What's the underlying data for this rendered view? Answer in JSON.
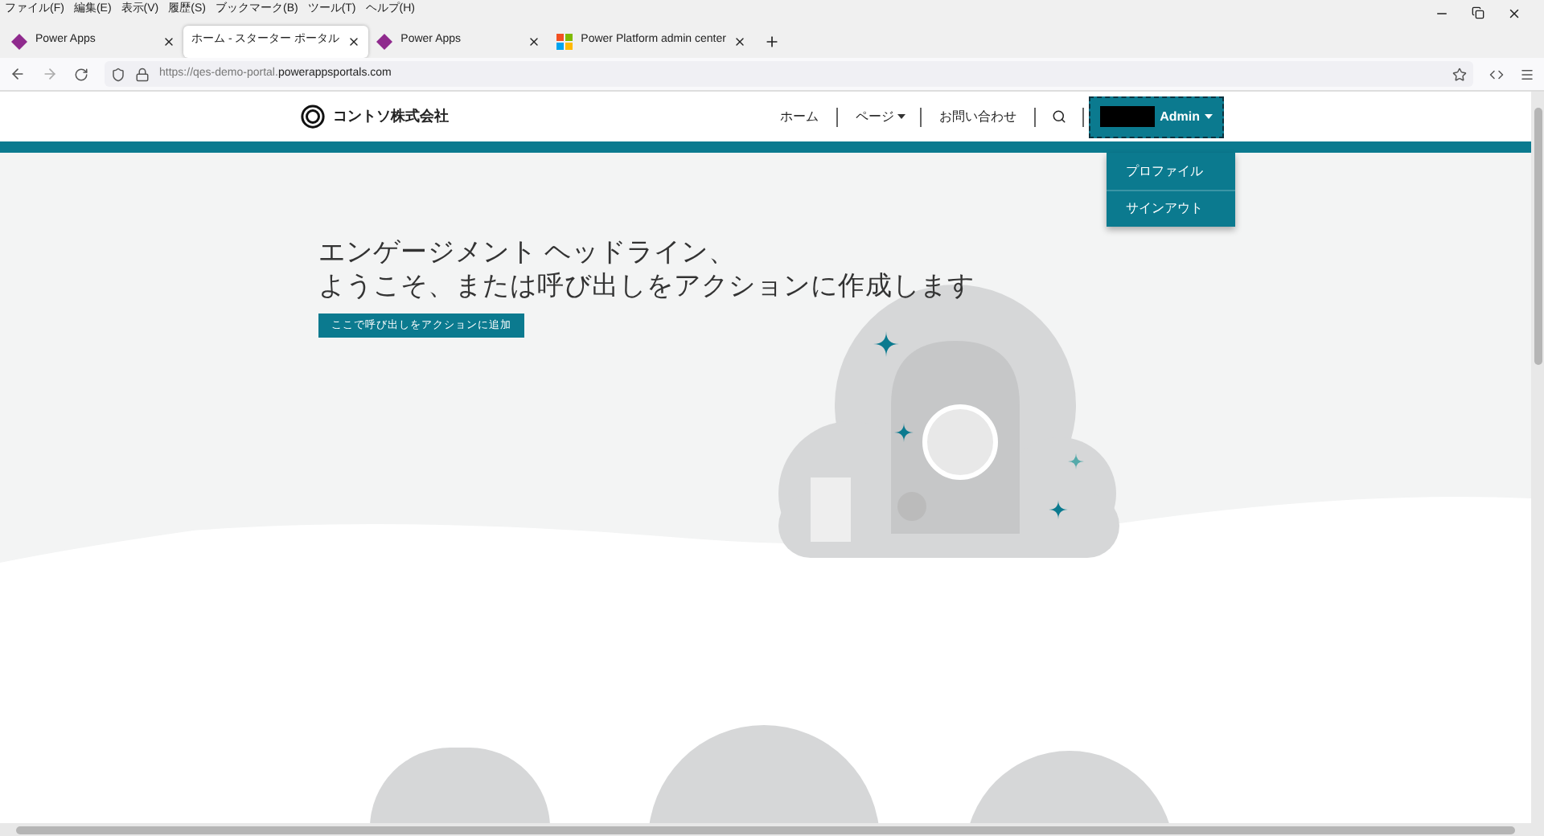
{
  "menu_bar": [
    "ファイル(F)",
    "編集(E)",
    "表示(V)",
    "履歴(S)",
    "ブックマーク(B)",
    "ツール(T)",
    "ヘルプ(H)"
  ],
  "tabs": [
    {
      "label": "Power Apps",
      "kind": "diamond",
      "selected": false
    },
    {
      "label": "ホーム - スターター ポータル",
      "kind": "plain",
      "selected": true
    },
    {
      "label": "Power Apps",
      "kind": "diamond",
      "selected": false
    },
    {
      "label": "Power Platform admin center",
      "kind": "squares",
      "selected": false
    }
  ],
  "address": {
    "prefix": "https://qes-demo-portal.",
    "domain": "powerappsportals.com"
  },
  "site": {
    "logo": "コントソ株式会社",
    "nav": [
      {
        "label": "ホーム",
        "dropdown": false
      },
      {
        "label": "ページ",
        "dropdown": true
      },
      {
        "label": "お問い合わせ",
        "dropdown": false
      }
    ],
    "user": {
      "label": "Admin",
      "expanded": true
    },
    "user_menu": [
      "プロファイル",
      "サインアウト"
    ]
  },
  "hero": {
    "headline": [
      "エンゲージメント ヘッドライン、",
      "ようこそ、または呼び出しをアクションに作成します"
    ],
    "button": "ここで呼び出しをアクションに追加"
  }
}
